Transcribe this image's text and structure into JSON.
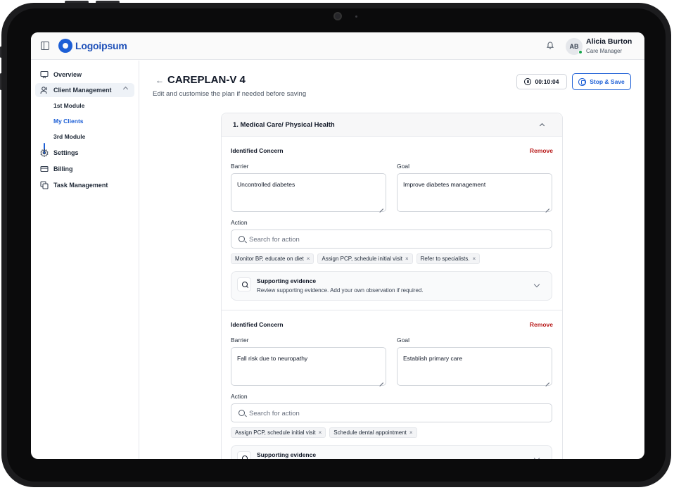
{
  "header": {
    "logo_text": "Logoipsum",
    "user": {
      "initials": "AB",
      "name": "Alicia Burton",
      "role": "Care Manager",
      "status_color": "#16a34a"
    }
  },
  "sidebar": {
    "items": [
      {
        "label": "Overview",
        "icon": "presentation-icon"
      },
      {
        "label": "Client Management",
        "icon": "users-icon"
      },
      {
        "label": "Settings",
        "icon": "gear-icon"
      },
      {
        "label": "Billing",
        "icon": "credit-card-icon"
      },
      {
        "label": "Task Management",
        "icon": "tasks-icon"
      }
    ],
    "sub_items": [
      {
        "label": "1st Module"
      },
      {
        "label": "My Clients",
        "active": true
      },
      {
        "label": "3rd Module"
      }
    ]
  },
  "page": {
    "back_icon": "arrow-left-icon",
    "title": "CAREPLAN-V 4",
    "subtitle": "Edit and customise the plan if needed before saving",
    "timer": "00:10:04",
    "stop_save_label": "Stop & Save"
  },
  "section": {
    "title": "1. Medical Care/ Physical Health",
    "concerns": [
      {
        "heading": "Identified Concern",
        "remove_label": "Remove",
        "barrier_label": "Barrier",
        "barrier_value": "Uncontrolled diabetes",
        "goal_label": "Goal",
        "goal_value": "Improve diabetes management",
        "action_label": "Action",
        "search_placeholder": "Search for action",
        "tags": [
          "Monitor BP, educate on diet",
          "Assign PCP, schedule initial visit",
          "Refer to specialists."
        ],
        "evidence_title": "Supporting evidence",
        "evidence_desc": "Review supporting evidence. Add your own observation if required."
      },
      {
        "heading": "Identified Concern",
        "remove_label": "Remove",
        "barrier_label": "Barrier",
        "barrier_value": "Fall risk due to neuropathy",
        "goal_label": "Goal",
        "goal_value": "Establish primary care",
        "action_label": "Action",
        "search_placeholder": "Search for action",
        "tags": [
          "Assign PCP, schedule initial visit",
          "Schedule dental appointment"
        ],
        "evidence_title": "Supporting evidence"
      }
    ]
  },
  "colors": {
    "accent": "#1d5fd6",
    "danger": "#b91c1c"
  }
}
